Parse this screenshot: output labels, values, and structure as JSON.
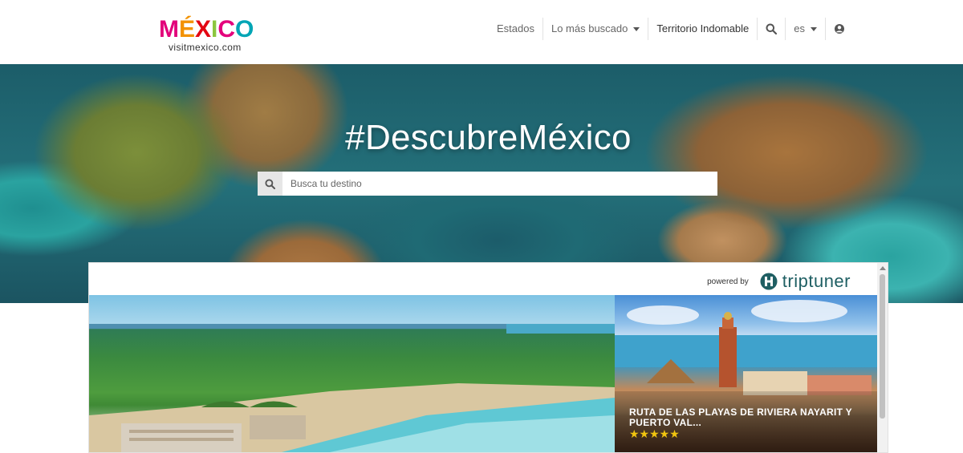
{
  "header": {
    "logo": {
      "text": "MÉXICO",
      "subtitle": "visitmexico.com"
    },
    "nav": {
      "estados": "Estados",
      "lo_mas_buscado": "Lo más buscado",
      "territorio": "Territorio Indomable",
      "language": "es"
    },
    "icons": [
      "search-icon",
      "user-icon",
      "caret-down-icon"
    ]
  },
  "hero": {
    "title": "#DescubreMéxico",
    "search_placeholder": "Busca tu destino"
  },
  "widget": {
    "powered_by": "powered by",
    "partner": "triptuner",
    "cards": [
      {
        "title": ""
      },
      {
        "title": "RUTA DE LAS PLAYAS DE RIVIERA NAYARIT Y PUERTO VAL...",
        "rating": 5,
        "stars": "★★★★★"
      }
    ]
  },
  "colors": {
    "accent_teal": "#1f5f63",
    "star": "#f1c40f",
    "logo_m": "#e2007a",
    "logo_e": "#f39200",
    "logo_x": "#e30613",
    "logo_i": "#8cc63f",
    "logo_c": "#e4007c",
    "logo_o": "#00a5b5"
  }
}
